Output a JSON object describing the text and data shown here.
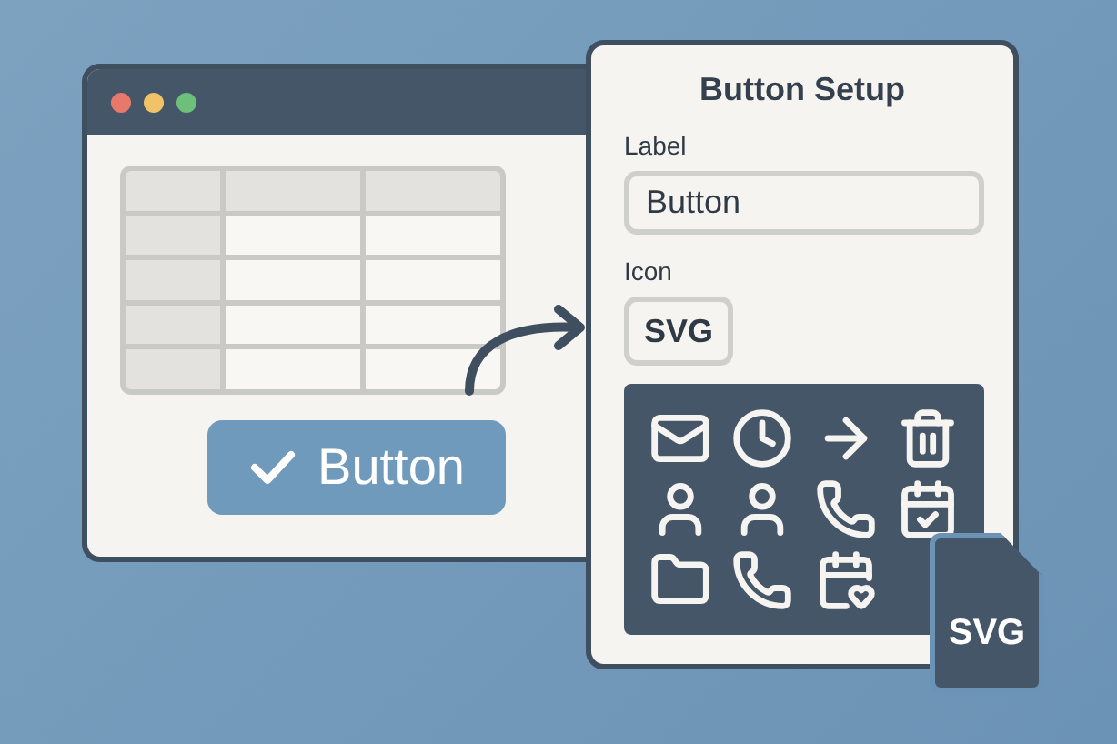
{
  "editor_window": {
    "button": {
      "label": "Button"
    }
  },
  "setup_panel": {
    "title": "Button Setup",
    "fields": [
      {
        "kind": "text",
        "label": "Label",
        "value": "Button"
      },
      {
        "kind": "chip",
        "label": "Icon",
        "value": "SVG"
      }
    ]
  },
  "file_badge": {
    "label": "SVG"
  }
}
